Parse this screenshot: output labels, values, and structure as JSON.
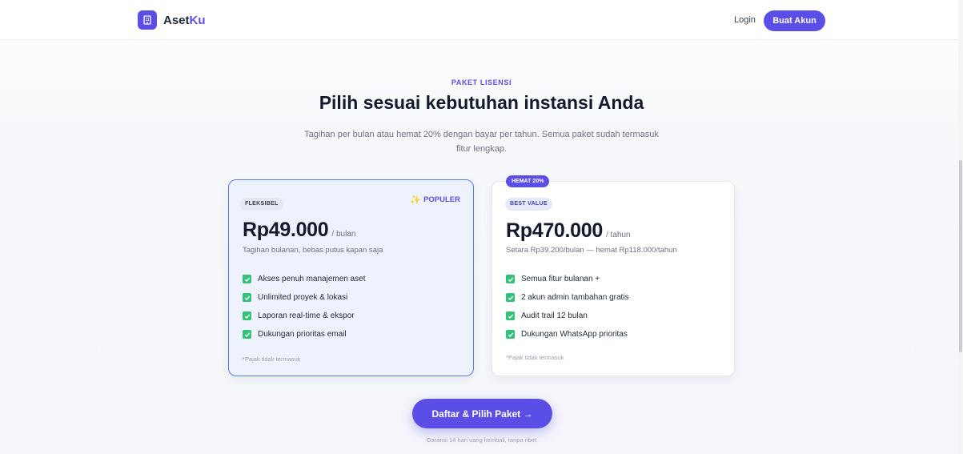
{
  "brand": {
    "name_main": "Aset",
    "name_accent": "Ku"
  },
  "header": {
    "login_label": "Login",
    "signup_label": "Buat Akun"
  },
  "hero": {
    "eyebrow": "PAKET LISENSI",
    "title": "Pilih sesuai kebutuhan instansi Anda",
    "subtitle": "Tagihan per bulan atau hemat 20% dengan bayar per tahun. Semua paket sudah termasuk fitur lengkap."
  },
  "plans": [
    {
      "tag": "FLEKSIBEL",
      "badge": "POPULER",
      "price": "Rp49.000",
      "period": "/ bulan",
      "note": "Tagihan bulanan, bebas putus kapan saja",
      "features": [
        "Akses penuh manajemen aset",
        "Unlimited proyek & lokasi",
        "Laporan real-time & ekspor",
        "Dukungan prioritas email"
      ],
      "tax_note": "*Pajak tidak termasuk"
    },
    {
      "save_tag": "HEMAT 20%",
      "tag": "BEST VALUE",
      "price": "Rp470.000",
      "period": "/ tahun",
      "note": "Setara Rp39.200/bulan — hemat Rp118.000/tahun",
      "features": [
        "Semua fitur bulanan +",
        "2 akun admin tambahan gratis",
        "Audit trail 12 bulan",
        "Dukungan WhatsApp prioritas"
      ],
      "tax_note": "*Pajak tidak termasuk"
    }
  ],
  "cta": {
    "label": "Daftar & Pilih Paket →",
    "guarantee": "Garansi 14 hari uang kembali, tanpa ribet"
  },
  "colors": {
    "primary": "#5b4ee6",
    "check": "#32c27a",
    "highlight_border": "#5b7be0",
    "highlight_bg": "#eef2fd"
  },
  "icons": {
    "brand": "building-icon",
    "popular": "sparkle-icon",
    "feature": "check-icon"
  }
}
